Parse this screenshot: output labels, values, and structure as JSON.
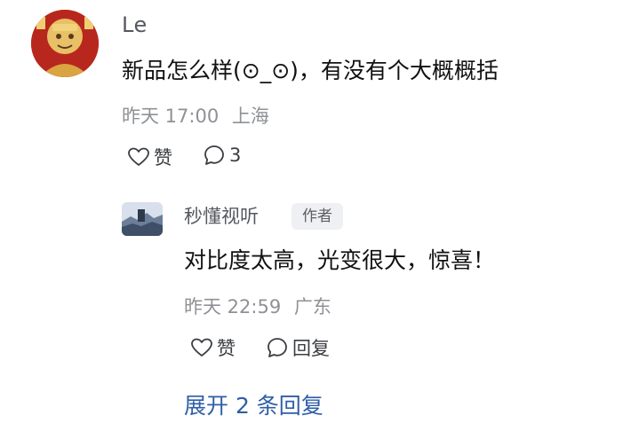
{
  "comment": {
    "author": "Le",
    "text": "新品怎么样(⊙_⊙)，有没有个大概概括",
    "time": "昨天 17:00",
    "location": "上海",
    "like_label": "赞",
    "reply_count": "3",
    "avatar_icon": "ornate-figure-avatar"
  },
  "reply": {
    "author": "秒懂视听",
    "badge": "作者",
    "text": "对比度太高，光变很大，惊喜！",
    "time": "昨天 22:59",
    "location": "广东",
    "like_label": "赞",
    "reply_label": "回复",
    "avatar_icon": "landscape-photo-avatar"
  },
  "expand_label": "展开 2 条回复",
  "colors": {
    "link": "#2f5ea8",
    "meta": "#8e9196",
    "badge_bg": "#eef0f4"
  }
}
